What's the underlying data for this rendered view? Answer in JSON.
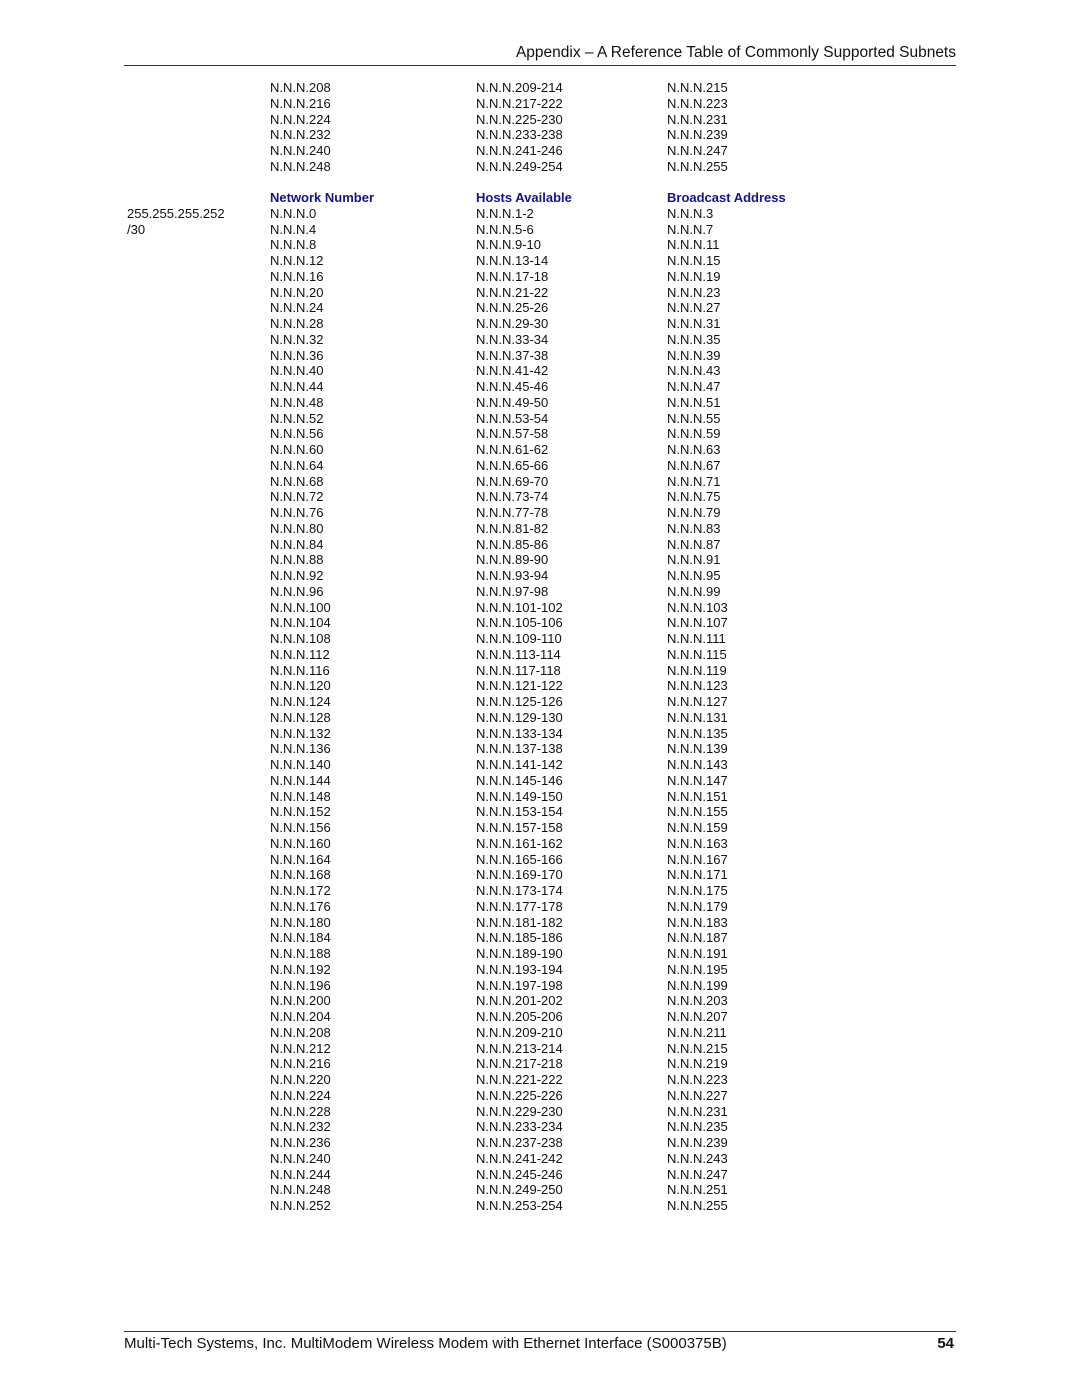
{
  "header": {
    "title": "Appendix – A Reference Table of Commonly Supported Subnets"
  },
  "top_rows": [
    {
      "network": "N.N.N.208",
      "hosts": "N.N.N.209-214",
      "broadcast": "N.N.N.215"
    },
    {
      "network": "N.N.N.216",
      "hosts": "N.N.N.217-222",
      "broadcast": "N.N.N.223"
    },
    {
      "network": "N.N.N.224",
      "hosts": "N.N.N.225-230",
      "broadcast": "N.N.N.231"
    },
    {
      "network": "N.N.N.232",
      "hosts": "N.N.N.233-238",
      "broadcast": "N.N.N.239"
    },
    {
      "network": "N.N.N.240",
      "hosts": "N.N.N.241-246",
      "broadcast": "N.N.N.247"
    },
    {
      "network": "N.N.N.248",
      "hosts": "N.N.N.249-254",
      "broadcast": "N.N.N.255"
    }
  ],
  "columns": {
    "network": "Network Number",
    "hosts": "Hosts Available",
    "broadcast": "Broadcast Address"
  },
  "mask": {
    "dotted": "255.255.255.252",
    "cidr": "/30"
  },
  "rows": [
    {
      "network": "N.N.N.0",
      "hosts": "N.N.N.1-2",
      "broadcast": "N.N.N.3"
    },
    {
      "network": "N.N.N.4",
      "hosts": "N.N.N.5-6",
      "broadcast": "N.N.N.7"
    },
    {
      "network": "N.N.N.8",
      "hosts": "N.N.N.9-10",
      "broadcast": "N.N.N.11"
    },
    {
      "network": "N.N.N.12",
      "hosts": "N.N.N.13-14",
      "broadcast": "N.N.N.15"
    },
    {
      "network": "N.N.N.16",
      "hosts": "N.N.N.17-18",
      "broadcast": "N.N.N.19"
    },
    {
      "network": "N.N.N.20",
      "hosts": "N.N.N.21-22",
      "broadcast": "N.N.N.23"
    },
    {
      "network": "N.N.N.24",
      "hosts": "N.N.N.25-26",
      "broadcast": "N.N.N.27"
    },
    {
      "network": "N.N.N.28",
      "hosts": "N.N.N.29-30",
      "broadcast": "N.N.N.31"
    },
    {
      "network": "N.N.N.32",
      "hosts": "N.N.N.33-34",
      "broadcast": "N.N.N.35"
    },
    {
      "network": "N.N.N.36",
      "hosts": "N.N.N.37-38",
      "broadcast": "N.N.N.39"
    },
    {
      "network": "N.N.N.40",
      "hosts": "N.N.N.41-42",
      "broadcast": "N.N.N.43"
    },
    {
      "network": "N.N.N.44",
      "hosts": "N.N.N.45-46",
      "broadcast": "N.N.N.47"
    },
    {
      "network": "N.N.N.48",
      "hosts": "N.N.N.49-50",
      "broadcast": "N.N.N.51"
    },
    {
      "network": "N.N.N.52",
      "hosts": "N.N.N.53-54",
      "broadcast": "N.N.N.55"
    },
    {
      "network": "N.N.N.56",
      "hosts": "N.N.N.57-58",
      "broadcast": "N.N.N.59"
    },
    {
      "network": "N.N.N.60",
      "hosts": "N.N.N.61-62",
      "broadcast": "N.N.N.63"
    },
    {
      "network": "N.N.N.64",
      "hosts": "N.N.N.65-66",
      "broadcast": "N.N.N.67"
    },
    {
      "network": "N.N.N.68",
      "hosts": "N.N.N.69-70",
      "broadcast": "N.N.N.71"
    },
    {
      "network": "N.N.N.72",
      "hosts": "N.N.N.73-74",
      "broadcast": "N.N.N.75"
    },
    {
      "network": "N.N.N.76",
      "hosts": "N.N.N.77-78",
      "broadcast": "N.N.N.79"
    },
    {
      "network": "N.N.N.80",
      "hosts": "N.N.N.81-82",
      "broadcast": "N.N.N.83"
    },
    {
      "network": "N.N.N.84",
      "hosts": "N.N.N.85-86",
      "broadcast": "N.N.N.87"
    },
    {
      "network": "N.N.N.88",
      "hosts": "N.N.N.89-90",
      "broadcast": "N.N.N.91"
    },
    {
      "network": "N.N.N.92",
      "hosts": "N.N.N.93-94",
      "broadcast": "N.N.N.95"
    },
    {
      "network": "N.N.N.96",
      "hosts": "N.N.N.97-98",
      "broadcast": "N.N.N.99"
    },
    {
      "network": "N.N.N.100",
      "hosts": "N.N.N.101-102",
      "broadcast": "N.N.N.103"
    },
    {
      "network": "N.N.N.104",
      "hosts": "N.N.N.105-106",
      "broadcast": "N.N.N.107"
    },
    {
      "network": "N.N.N.108",
      "hosts": "N.N.N.109-110",
      "broadcast": "N.N.N.111"
    },
    {
      "network": "N.N.N.112",
      "hosts": "N.N.N.113-114",
      "broadcast": "N.N.N.115"
    },
    {
      "network": "N.N.N.116",
      "hosts": "N.N.N.117-118",
      "broadcast": "N.N.N.119"
    },
    {
      "network": "N.N.N.120",
      "hosts": "N.N.N.121-122",
      "broadcast": "N.N.N.123"
    },
    {
      "network": "N.N.N.124",
      "hosts": "N.N.N.125-126",
      "broadcast": "N.N.N.127"
    },
    {
      "network": "N.N.N.128",
      "hosts": "N.N.N.129-130",
      "broadcast": "N.N.N.131"
    },
    {
      "network": "N.N.N.132",
      "hosts": "N.N.N.133-134",
      "broadcast": "N.N.N.135"
    },
    {
      "network": "N.N.N.136",
      "hosts": "N.N.N.137-138",
      "broadcast": "N.N.N.139"
    },
    {
      "network": "N.N.N.140",
      "hosts": "N.N.N.141-142",
      "broadcast": "N.N.N.143"
    },
    {
      "network": "N.N.N.144",
      "hosts": "N.N.N.145-146",
      "broadcast": "N.N.N.147"
    },
    {
      "network": "N.N.N.148",
      "hosts": "N.N.N.149-150",
      "broadcast": "N.N.N.151"
    },
    {
      "network": "N.N.N.152",
      "hosts": "N.N.N.153-154",
      "broadcast": "N.N.N.155"
    },
    {
      "network": "N.N.N.156",
      "hosts": "N.N.N.157-158",
      "broadcast": "N.N.N.159"
    },
    {
      "network": "N.N.N.160",
      "hosts": "N.N.N.161-162",
      "broadcast": "N.N.N.163"
    },
    {
      "network": "N.N.N.164",
      "hosts": "N.N.N.165-166",
      "broadcast": "N.N.N.167"
    },
    {
      "network": "N.N.N.168",
      "hosts": "N.N.N.169-170",
      "broadcast": "N.N.N.171"
    },
    {
      "network": "N.N.N.172",
      "hosts": "N.N.N.173-174",
      "broadcast": "N.N.N.175"
    },
    {
      "network": "N.N.N.176",
      "hosts": "N.N.N.177-178",
      "broadcast": "N.N.N.179"
    },
    {
      "network": "N.N.N.180",
      "hosts": "N.N.N.181-182",
      "broadcast": "N.N.N.183"
    },
    {
      "network": "N.N.N.184",
      "hosts": "N.N.N.185-186",
      "broadcast": "N.N.N.187"
    },
    {
      "network": "N.N.N.188",
      "hosts": "N.N.N.189-190",
      "broadcast": "N.N.N.191"
    },
    {
      "network": "N.N.N.192",
      "hosts": "N.N.N.193-194",
      "broadcast": "N.N.N.195"
    },
    {
      "network": "N.N.N.196",
      "hosts": "N.N.N.197-198",
      "broadcast": "N.N.N.199"
    },
    {
      "network": "N.N.N.200",
      "hosts": "N.N.N.201-202",
      "broadcast": "N.N.N.203"
    },
    {
      "network": "N.N.N.204",
      "hosts": "N.N.N.205-206",
      "broadcast": "N.N.N.207"
    },
    {
      "network": "N.N.N.208",
      "hosts": "N.N.N.209-210",
      "broadcast": "N.N.N.211"
    },
    {
      "network": "N.N.N.212",
      "hosts": "N.N.N.213-214",
      "broadcast": "N.N.N.215"
    },
    {
      "network": "N.N.N.216",
      "hosts": "N.N.N.217-218",
      "broadcast": "N.N.N.219"
    },
    {
      "network": "N.N.N.220",
      "hosts": "N.N.N.221-222",
      "broadcast": "N.N.N.223"
    },
    {
      "network": "N.N.N.224",
      "hosts": "N.N.N.225-226",
      "broadcast": "N.N.N.227"
    },
    {
      "network": "N.N.N.228",
      "hosts": "N.N.N.229-230",
      "broadcast": "N.N.N.231"
    },
    {
      "network": "N.N.N.232",
      "hosts": "N.N.N.233-234",
      "broadcast": "N.N.N.235"
    },
    {
      "network": "N.N.N.236",
      "hosts": "N.N.N.237-238",
      "broadcast": "N.N.N.239"
    },
    {
      "network": "N.N.N.240",
      "hosts": "N.N.N.241-242",
      "broadcast": "N.N.N.243"
    },
    {
      "network": "N.N.N.244",
      "hosts": "N.N.N.245-246",
      "broadcast": "N.N.N.247"
    },
    {
      "network": "N.N.N.248",
      "hosts": "N.N.N.249-250",
      "broadcast": "N.N.N.251"
    },
    {
      "network": "N.N.N.252",
      "hosts": "N.N.N.253-254",
      "broadcast": "N.N.N.255"
    }
  ],
  "footer": {
    "text": "Multi-Tech Systems, Inc. MultiModem Wireless Modem with Ethernet Interface (S000375B)",
    "page": "54"
  }
}
